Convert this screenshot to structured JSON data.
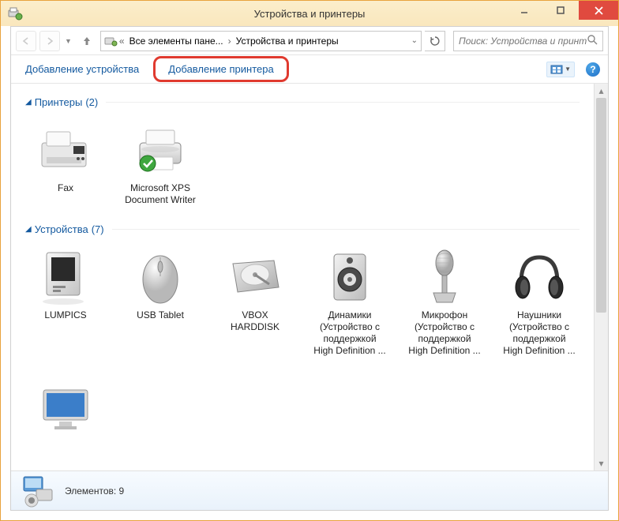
{
  "window": {
    "title": "Устройства и принтеры"
  },
  "breadcrumb": {
    "seg1": "Все элементы пане...",
    "seg2": "Устройства и принтеры"
  },
  "search": {
    "placeholder": "Поиск: Устройства и принте..."
  },
  "toolbar": {
    "add_device": "Добавление устройства",
    "add_printer": "Добавление принтера"
  },
  "groups": {
    "printers": {
      "label": "Принтеры",
      "count": "(2)"
    },
    "devices": {
      "label": "Устройства",
      "count": "(7)"
    }
  },
  "printers": [
    {
      "name": "Fax"
    },
    {
      "name": "Microsoft XPS Document Writer"
    }
  ],
  "devices": [
    {
      "name": "LUMPICS"
    },
    {
      "name": "USB Tablet"
    },
    {
      "name": "VBOX HARDDISK"
    },
    {
      "name": "Динамики (Устройство с поддержкой High Definition ..."
    },
    {
      "name": "Микрофон (Устройство с поддержкой High Definition ..."
    },
    {
      "name": "Наушники (Устройство с поддержкой High Definition ..."
    }
  ],
  "statusbar": {
    "count_label": "Элементов: 9"
  }
}
